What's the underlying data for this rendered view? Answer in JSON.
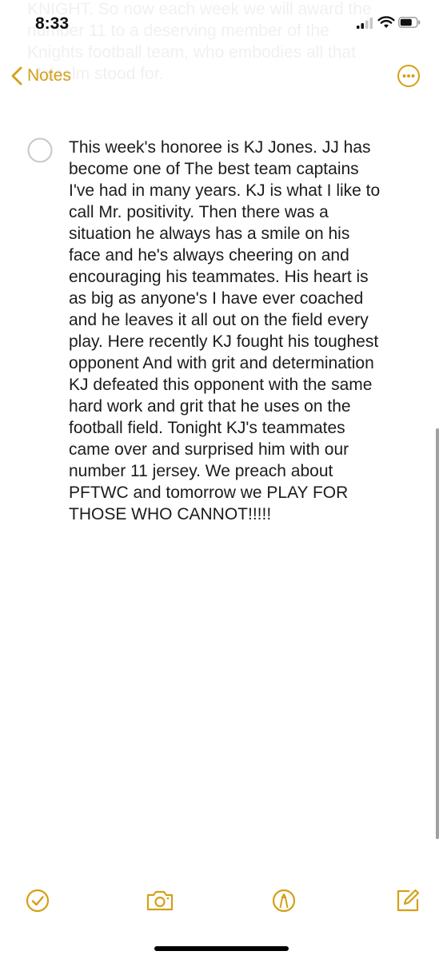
{
  "status_bar": {
    "time": "8:33"
  },
  "ghost_text": "KNIGHT. So now each week we will award the\nnumber 11 to a deserving member of the\nKnights football team, who embodies all that\nMalcolm stood for.",
  "nav": {
    "back_label": "Notes",
    "accent_color": "#d4a017"
  },
  "note": {
    "checklist_item_text": "This week's honoree is KJ Jones. JJ has\nbecome one of The best team captains\nI've had in many years. KJ is what I like to\ncall Mr. positivity. Then there was a\nsituation he always has a smile on his\nface and he's always cheering on and\nencouraging his teammates. His heart is\nas big as anyone's I have ever coached\nand he leaves it all out on the field every\nplay. Here recently KJ fought his toughest\nopponent And with grit and determination\nKJ defeated this opponent with the same\nhard work and grit that he uses on the\nfootball field. Tonight KJ's teammates\ncame over and surprised him with our\nnumber 11 jersey. We preach about\nPFTWC and tomorrow we PLAY FOR\nTHOSE WHO CANNOT!!!!!",
    "checked": false
  },
  "toolbar": {
    "icons": [
      "checklist-icon",
      "camera-icon",
      "markup-icon",
      "compose-icon"
    ]
  }
}
